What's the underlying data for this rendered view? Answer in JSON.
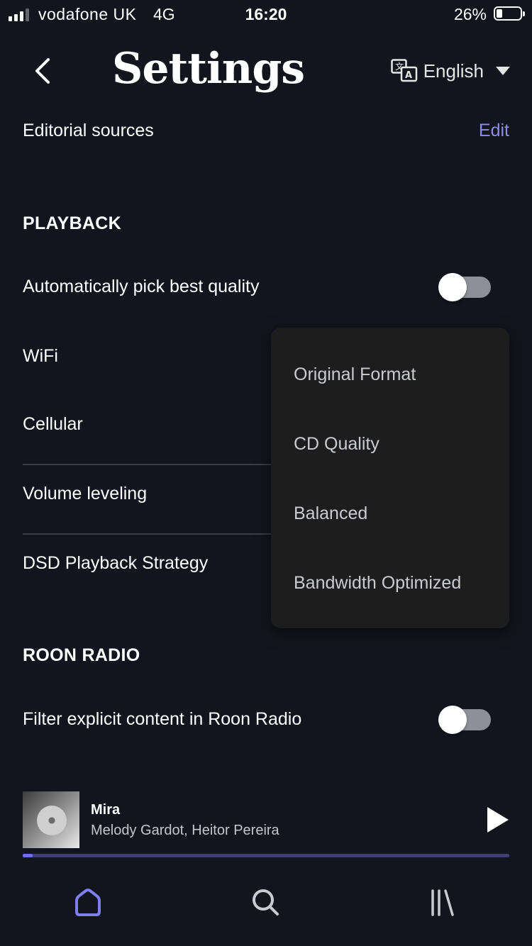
{
  "status_bar": {
    "carrier": "vodafone UK",
    "network": "4G",
    "time": "16:20",
    "battery_percent": "26%"
  },
  "header": {
    "title": "Settings",
    "language": "English",
    "back_icon": "chevron-left-icon",
    "language_icon": "translate-icon"
  },
  "editorial": {
    "label": "Editorial sources",
    "edit_label": "Edit"
  },
  "playback": {
    "section_title": "PLAYBACK",
    "auto_quality_label": "Automatically pick best quality",
    "auto_quality_on": false,
    "wifi_label": "WiFi",
    "cellular_label": "Cellular",
    "volume_leveling_label": "Volume leveling",
    "dsd_label": "DSD Playback Strategy"
  },
  "quality_menu": {
    "options": [
      "Original Format",
      "CD Quality",
      "Balanced",
      "Bandwidth Optimized"
    ]
  },
  "roon_radio": {
    "section_title": "ROON RADIO",
    "filter_explicit_label": "Filter explicit content in Roon Radio",
    "filter_explicit_on": false
  },
  "now_playing": {
    "title": "Mira",
    "artist": "Melody Gardot, Heitor Pereira",
    "progress": 0.02,
    "play_icon": "play-icon"
  },
  "bottom_nav": {
    "items": [
      "home-icon",
      "search-icon",
      "library-icon"
    ],
    "active": "home-icon"
  },
  "colors": {
    "background": "#12151d",
    "accent": "#8a8ee8",
    "menu_background": "#1d1d1e",
    "progress_fill": "#6b6fe0"
  }
}
